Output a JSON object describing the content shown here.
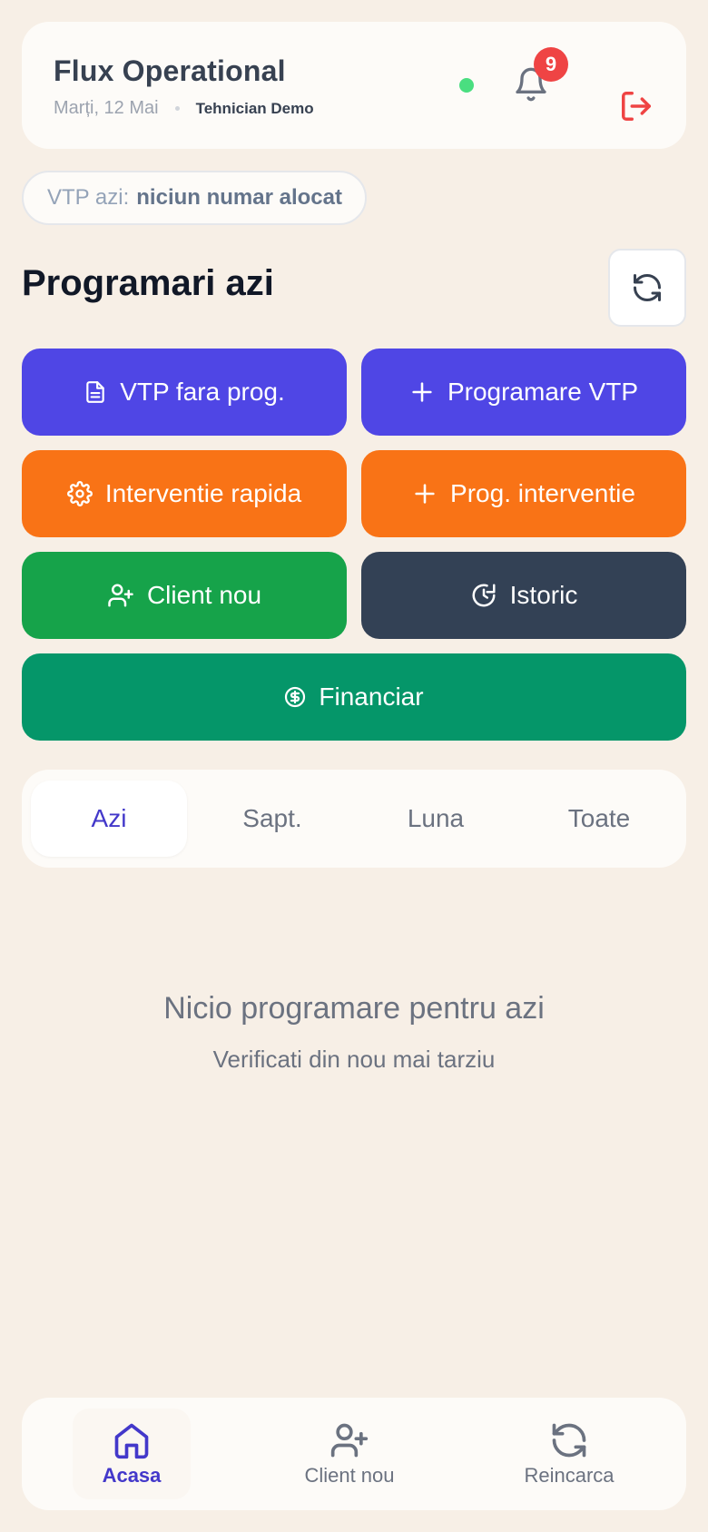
{
  "header": {
    "title": "Flux Operational",
    "date": "Marți, 12 Mai",
    "user": "Tehnician Demo",
    "notification_count": "9"
  },
  "vtp": {
    "label": "VTP azi:",
    "value": "niciun numar alocat"
  },
  "section": {
    "title": "Programari azi"
  },
  "actions": {
    "vtp_no_prog": "VTP fara prog.",
    "prog_vtp": "Programare VTP",
    "quick_intervention": "Interventie rapida",
    "prog_intervention": "Prog. interventie",
    "new_client": "Client nou",
    "history": "Istoric",
    "financial": "Financiar"
  },
  "tabs": [
    {
      "label": "Azi"
    },
    {
      "label": "Sapt."
    },
    {
      "label": "Luna"
    },
    {
      "label": "Toate"
    }
  ],
  "empty_state": {
    "title": "Nicio programare pentru azi",
    "subtitle": "Verificati din nou mai tarziu"
  },
  "bottom_nav": [
    {
      "label": "Acasa",
      "icon": "home-icon"
    },
    {
      "label": "Client nou",
      "icon": "user-plus-icon"
    },
    {
      "label": "Reincarca",
      "icon": "refresh-icon"
    }
  ],
  "colors": {
    "indigo": "#4f46e5",
    "orange": "#f97316",
    "green": "#16a34a",
    "slate": "#334155",
    "emerald": "#059669",
    "danger": "#ef4444",
    "online": "#4ade80"
  }
}
